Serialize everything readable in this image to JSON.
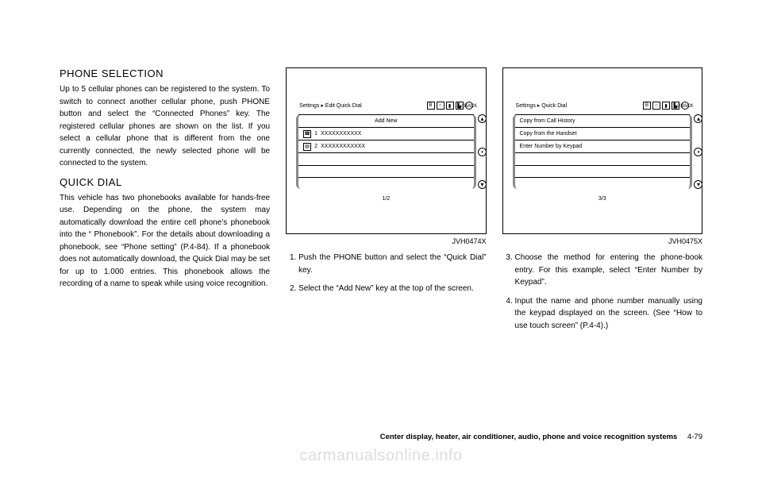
{
  "col1": {
    "heading1": "PHONE SELECTION",
    "para1": "Up to 5 cellular phones can be registered to the system. To switch to connect another cellular phone, push PHONE button and select the “Connected Phones” key. The registered cellular phones are shown on the list. If you select a cellular phone that is different from the one currently connected, the newly selected phone will be connected to the system.",
    "heading2": "QUICK DIAL",
    "para2": "This vehicle has two phonebooks available for hands-free use. Depending on the phone, the system may automatically download the entire cell phone’s phonebook into the “ Phonebook”. For the details about downloading a phonebook, see “Phone setting” (P.4-84). If a phonebook does not automatically download, the Quick Dial may be set for up to 1.000 entries. This phonebook allows the recording of a name to speak while using voice recognition."
  },
  "fig1": {
    "breadcrumb": "Settings ▸ Edit Quick Dial",
    "back": "↺BACK",
    "items": [
      {
        "icon": "",
        "label": "Add New",
        "centered": true
      },
      {
        "icon": "☎",
        "num": "1",
        "label": "XXXXXXXXXXX"
      },
      {
        "icon": "▤",
        "num": "2",
        "label": "XXXXXXXXXXXX"
      },
      {
        "icon": "",
        "label": ""
      },
      {
        "icon": "",
        "label": ""
      }
    ],
    "pager": "1/2",
    "code": "JVH0474X"
  },
  "col2": {
    "step1": "Push the PHONE button and select the “Quick Dial” key.",
    "step2": "Select the “Add New” key at the top of the screen."
  },
  "fig2": {
    "breadcrumb": "Settings ▸ Quick Dial",
    "back": "↺BACK",
    "items": [
      {
        "label": "Copy from Call History"
      },
      {
        "label": "Copy from the Handset"
      },
      {
        "label": "Enter Number by Keypad"
      },
      {
        "label": ""
      },
      {
        "label": ""
      }
    ],
    "pager": "3/3",
    "code": "JVH0475X"
  },
  "col3": {
    "step3": "Choose the method for entering the phone-book entry. For this example, select “Enter Number by Keypad”.",
    "step4": "Input the name and phone number manually using the keypad displayed on the screen. (See “How to use touch screen” (P.4-4).)"
  },
  "footer": {
    "section": "Center display, heater, air conditioner, audio, phone and voice recognition systems",
    "pagenum": "4-79"
  },
  "watermark": "carmanualsonline.info"
}
